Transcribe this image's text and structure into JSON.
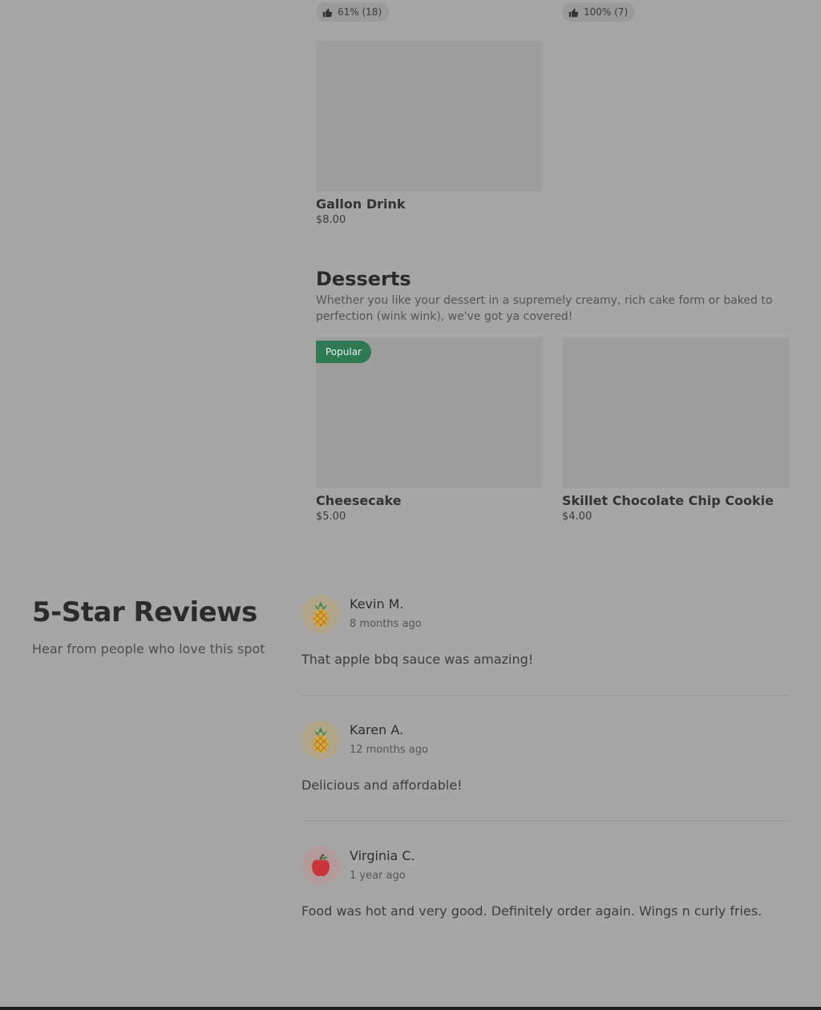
{
  "top_ratings": [
    {
      "label": "61% (18)"
    },
    {
      "label": "100% (7)"
    }
  ],
  "drinks": {
    "items": [
      {
        "name": "Gallon Drink",
        "price": "$8.00"
      }
    ]
  },
  "desserts": {
    "title": "Desserts",
    "description": "Whether you like your dessert in a supremely creamy, rich cake form or baked to perfection (wink wink), we've got ya covered!",
    "items": [
      {
        "name": "Cheesecake",
        "price": "$5.00",
        "badge": "Popular"
      },
      {
        "name": "Skillet Chocolate Chip Cookie",
        "price": "$4.00"
      }
    ]
  },
  "reviews": {
    "title": "5-Star Reviews",
    "subtitle": "Hear from people who love this spot",
    "items": [
      {
        "name": "Kevin M.",
        "time": "8 months ago",
        "text": "That apple bbq sauce was amazing!",
        "avatar_icon": "pineapple-icon"
      },
      {
        "name": "Karen A.",
        "time": "12 months ago",
        "text": "Delicious and affordable!",
        "avatar_icon": "pineapple-icon"
      },
      {
        "name": "Virginia C.",
        "time": "1 year ago",
        "text": "Food was hot and very good. Definitely order again. Wings n curly fries.",
        "avatar_icon": "apple-icon"
      }
    ]
  },
  "colors": {
    "overlay_background": "#a6a6a6",
    "popular_badge": "#2f7a52"
  }
}
